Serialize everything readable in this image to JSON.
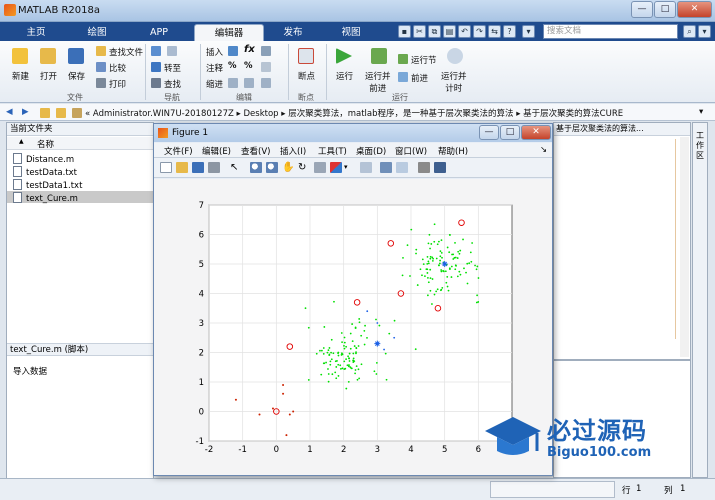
{
  "app": {
    "title": "MATLAB R2018a"
  },
  "ribbon_tabs": [
    "主页",
    "绘图",
    "APP",
    "编辑器",
    "发布",
    "视图"
  ],
  "active_tab": "编辑器",
  "search": {
    "placeholder": "搜索文档"
  },
  "ribbon": {
    "file": {
      "new": "新建",
      "open": "打开",
      "save": "保存",
      "find_files": "查找文件",
      "compare": "比较",
      "print": "打印",
      "group": "文件"
    },
    "nav": {
      "goto": "转至",
      "find": "查找",
      "group": "导航"
    },
    "edit": {
      "insert": "插入",
      "comment": "注释",
      "indent": "缩进",
      "group": "编辑"
    },
    "breakpoint": {
      "label": "断点",
      "group": "断点"
    },
    "run": {
      "run": "运行",
      "run_advance": "运行并\n前进",
      "run_section": "运行节",
      "advance": "前进",
      "run_time": "运行并\n计时",
      "group": "运行"
    }
  },
  "address": {
    "path": "« Administrator.WIN7U-20180127Z  ▸  Desktop  ▸  层次聚类算法，matlab程序，是一种基于层次聚类法的算法  ▸  基于层次聚类的算法CURE"
  },
  "left_panel": {
    "title": "当前文件夹",
    "col_name": "名称",
    "col_sort": "▲",
    "files": [
      "Distance.m",
      "testData.txt",
      "testData1.txt",
      "text_Cure.m"
    ],
    "selected": "text_Cure.m",
    "details_title": "text_Cure.m  (脚本)",
    "details_text": "导入数据"
  },
  "editor_side": {
    "label": "工作区",
    "path_snip": "基于层次聚类法的算法..."
  },
  "statusbar": {
    "row_label": "行",
    "row": "1",
    "col_label": "列",
    "col": "1"
  },
  "figure": {
    "title": "Figure 1",
    "menu": [
      "文件(F)",
      "编辑(E)",
      "查看(V)",
      "插入(I)",
      "工具(T)",
      "桌面(D)",
      "窗口(W)",
      "帮助(H)"
    ]
  },
  "watermark": {
    "brand": "必过源码",
    "url": "Biguo100.com"
  },
  "chart_data": {
    "type": "scatter",
    "xlim": [
      -2,
      7
    ],
    "ylim": [
      -1,
      7
    ],
    "xticks": [
      -2,
      -1,
      0,
      1,
      2,
      3,
      4,
      5,
      6
    ],
    "yticks": [
      -1,
      0,
      1,
      2,
      3,
      4,
      5,
      6,
      7
    ],
    "grid": true,
    "series": [
      {
        "color": "#00e000",
        "marker": "dot",
        "cluster_centers": [
          [
            2,
            1.9
          ],
          [
            5,
            5
          ]
        ]
      },
      {
        "color": "#e00000",
        "marker": "circle",
        "points": [
          [
            0.4,
            2.2
          ],
          [
            2.4,
            3.7
          ],
          [
            3.4,
            5.7
          ],
          [
            3.7,
            4.0
          ],
          [
            4.8,
            3.5
          ],
          [
            5.5,
            6.4
          ],
          [
            0,
            0
          ]
        ]
      },
      {
        "color": "#1a5fe6",
        "marker": "star",
        "points": [
          [
            3.0,
            2.3
          ],
          [
            5.0,
            5.0
          ]
        ]
      },
      {
        "color": "#cc2200",
        "marker": "dot",
        "points": [
          [
            -1.2,
            0.4
          ],
          [
            -0.5,
            -0.1
          ],
          [
            0.2,
            0.6
          ],
          [
            0.4,
            -0.1
          ],
          [
            0.3,
            -0.8
          ],
          [
            0.5,
            0.0
          ],
          [
            -0.1,
            0.1
          ],
          [
            0.2,
            0.9
          ]
        ]
      }
    ]
  },
  "colors": {
    "accent": "#1f4b8e",
    "ribbon_bg": "#f4f6f9"
  }
}
